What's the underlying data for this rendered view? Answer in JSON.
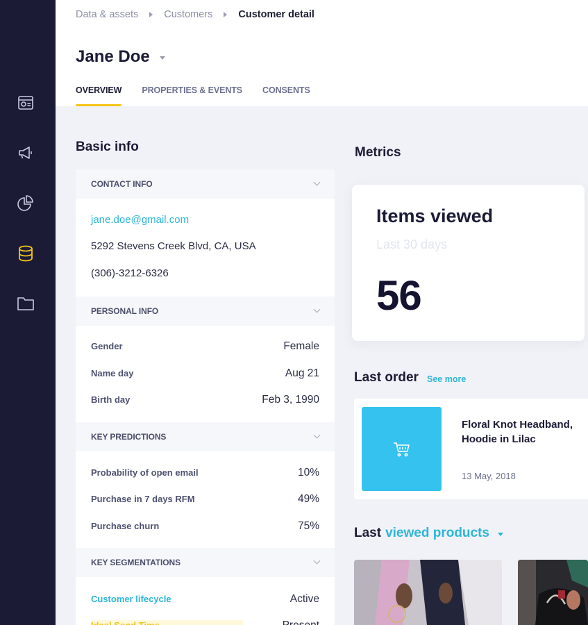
{
  "sidebar": {
    "items": [
      {
        "icon": "dashboard-icon"
      },
      {
        "icon": "megaphone-icon"
      },
      {
        "icon": "pie-chart-icon"
      },
      {
        "icon": "database-icon",
        "active": true
      },
      {
        "icon": "folder-icon"
      }
    ],
    "active_color": "#f5c518"
  },
  "breadcrumb": {
    "items": [
      "Data & assets",
      "Customers"
    ],
    "current": "Customer detail"
  },
  "header": {
    "title": "Jane Doe",
    "tabs": [
      {
        "label": "OVERVIEW",
        "active": true
      },
      {
        "label": "PROPERTIES & EVENTS"
      },
      {
        "label": "CONSENTS"
      }
    ]
  },
  "basic_info": {
    "title": "Basic info",
    "contact": {
      "header": "CONTACT INFO",
      "email": "jane.doe@gmail.com",
      "address": "5292 Stevens Creek Blvd, CA, USA",
      "phone": "(306)-3212-6326"
    },
    "personal": {
      "header": "PERSONAL INFO",
      "rows": [
        {
          "key": "Gender",
          "value": "Female"
        },
        {
          "key": "Name day",
          "value": "Aug 21"
        },
        {
          "key": "Birth day",
          "value": "Feb 3, 1990"
        }
      ]
    },
    "predictions": {
      "header": "KEY PREDICTIONS",
      "rows": [
        {
          "key": "Probability of open email",
          "value": "10%"
        },
        {
          "key": "Purchase in 7 days RFM",
          "value": "49%"
        },
        {
          "key": "Purchase churn",
          "value": "75%"
        }
      ]
    },
    "segmentations": {
      "header": "KEY SEGMENTATIONS",
      "rows": [
        {
          "key": "Customer lifecycle",
          "value": "Active"
        },
        {
          "key": "Ideal Send Time",
          "value": "Present"
        }
      ]
    }
  },
  "metrics": {
    "title": "Metrics",
    "card_title": "Items viewed",
    "card_subtitle": "Last 30 days",
    "card_value": "56"
  },
  "last_order": {
    "title": "Last order",
    "see_more": "See more",
    "product_line1": "Floral Knot Headband,",
    "product_line2": "Hoodie in Lilac",
    "date": "13 May, 2018",
    "thumb_icon": "shopping-cart-icon",
    "thumb_color": "#35c2ef"
  },
  "last_viewed": {
    "title_prefix": "Last",
    "title_accent": "viewed products",
    "accent_color": "#2cb6d9"
  }
}
